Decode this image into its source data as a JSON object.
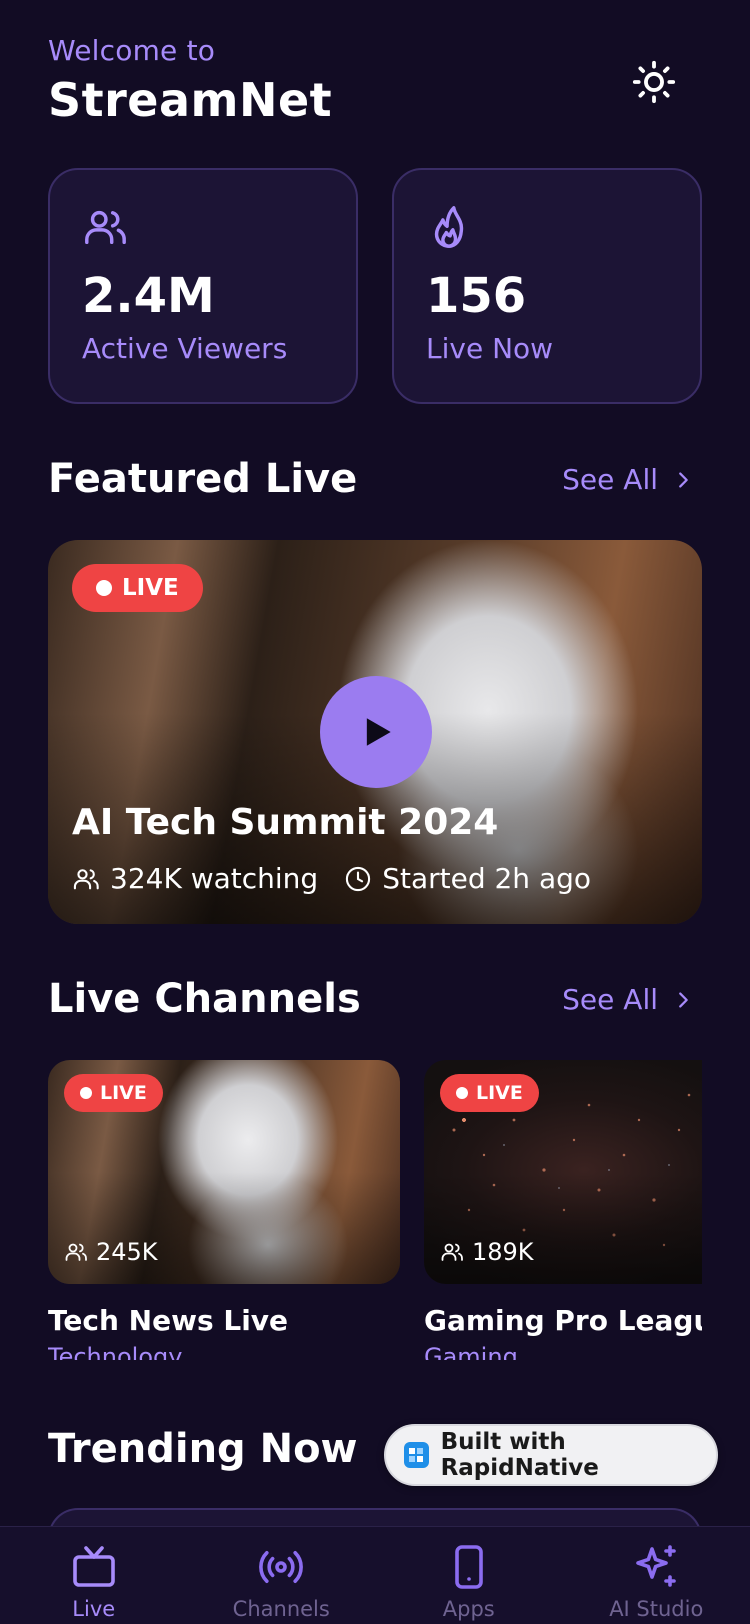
{
  "header": {
    "welcome": "Welcome to",
    "app_name": "StreamNet"
  },
  "stats": [
    {
      "icon": "users-icon",
      "value": "2.4M",
      "label": "Active Viewers"
    },
    {
      "icon": "flame-icon",
      "value": "156",
      "label": "Live Now"
    }
  ],
  "featured_section": {
    "title": "Featured Live",
    "see_all": "See All"
  },
  "featured": {
    "badge": "LIVE",
    "title": "AI Tech Summit 2024",
    "watching": "324K watching",
    "started": "Started 2h ago"
  },
  "channels_section": {
    "title": "Live Channels",
    "see_all": "See All"
  },
  "channels": [
    {
      "badge": "LIVE",
      "viewers": "245K",
      "title": "Tech News Live",
      "category": "Technology"
    },
    {
      "badge": "LIVE",
      "viewers": "189K",
      "title": "Gaming Pro League",
      "category": "Gaming"
    }
  ],
  "trending_section": {
    "title": "Trending Now"
  },
  "built_with": "Built with RapidNative",
  "tabs": [
    {
      "label": "Live",
      "icon": "tv-icon",
      "active": true
    },
    {
      "label": "Channels",
      "icon": "broadcast-icon",
      "active": false
    },
    {
      "label": "Apps",
      "icon": "phone-icon",
      "active": false
    },
    {
      "label": "AI Studio",
      "icon": "sparkles-icon",
      "active": false
    }
  ],
  "colors": {
    "background": "#120c24",
    "accent": "#a78bfa",
    "live": "#ef4444",
    "play": "#9b7cf0"
  }
}
